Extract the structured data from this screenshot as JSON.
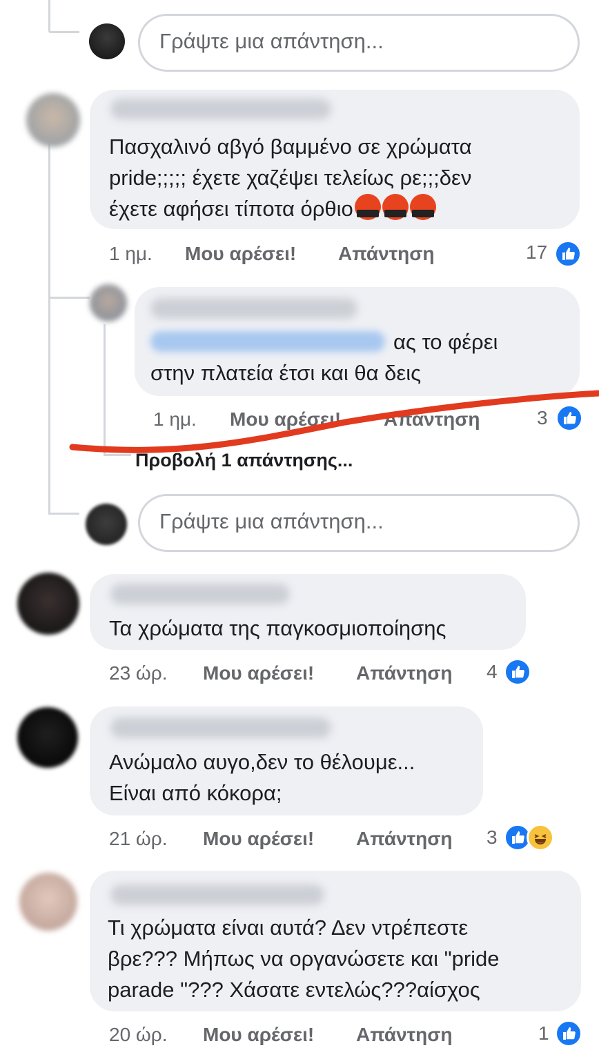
{
  "reply_placeholder": "Γράψτε μια απάντηση...",
  "comments": [
    {
      "text_lines": [
        "Πασχαλινό αβγό βαμμένο σε χρώματα",
        "pride;;;;; έχετε χαζέψει τελείως ρε;;;δεν",
        "έχετε αφήσει τίποτα όρθιο"
      ],
      "emojis": [
        "angry-face-emoji",
        "angry-face-emoji",
        "angry-face-emoji"
      ],
      "time": "1 ημ.",
      "like_label": "Μου αρέσει!",
      "reply_label": "Απάντηση",
      "reaction_count": "17",
      "reaction_icons": [
        "like-icon"
      ]
    },
    {
      "text_after_mention": "ας το φέρει",
      "text_line2": "στην πλατεία έτσι και θα δεις",
      "time": "1 ημ.",
      "like_label": "Μου αρέσει!",
      "reply_label": "Απάντηση",
      "reaction_count": "3",
      "reaction_icons": [
        "like-icon"
      ],
      "view_replies": "Προβολή 1 απάντησης..."
    },
    {
      "text_lines": [
        "Τα χρώματα της παγκοσμιοποίησης"
      ],
      "time": "23 ώρ.",
      "like_label": "Μου αρέσει!",
      "reply_label": "Απάντηση",
      "reaction_count": "4",
      "reaction_icons": [
        "like-icon"
      ]
    },
    {
      "text_lines": [
        "Ανώμαλο αυγο,δεν το θέλουμε...",
        "Είναι από κόκορα;"
      ],
      "time": "21 ώρ.",
      "like_label": "Μου αρέσει!",
      "reply_label": "Απάντηση",
      "reaction_count": "3",
      "reaction_icons": [
        "like-icon",
        "haha-icon"
      ]
    },
    {
      "text_lines": [
        "Τι χρώματα είναι αυτά? Δεν ντρέπεστε",
        "βρε??? Μήπως να οργανώσετε και \"pride",
        "parade \"??? Χάσατε εντελώς???αίσχος"
      ],
      "time": "20 ώρ.",
      "like_label": "Μου αρέσει!",
      "reply_label": "Απάντηση",
      "reaction_count": "1",
      "reaction_icons": [
        "like-icon"
      ]
    }
  ],
  "colors": {
    "accent": "#1877f2",
    "bubble": "#eef0f4",
    "annotation_stroke": "#e23a1e"
  }
}
